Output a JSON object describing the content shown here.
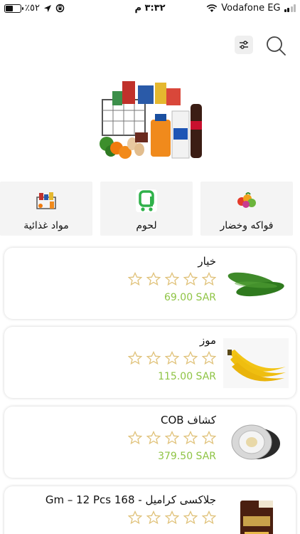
{
  "status_bar": {
    "battery_percent": "٪٥٢",
    "battery_level": 0.52,
    "time": "٣:٣٢ م",
    "carrier": "Vodafone EG"
  },
  "toolbar": {
    "filter_icon": "sliders-icon",
    "search_icon": "search-icon"
  },
  "hero": {
    "icon": "grocery-basket-illustration"
  },
  "categories": [
    {
      "label": "فواكه وخضار",
      "icon": "fruits-vegetables-icon"
    },
    {
      "label": "لحوم",
      "icon": "cart-logo-icon"
    },
    {
      "label": "مواد غذائية",
      "icon": "groceries-icon"
    }
  ],
  "products": [
    {
      "name": "خيار",
      "price": "69.00 SAR",
      "rating": 0,
      "image": "cucumber-image"
    },
    {
      "name": "موز",
      "price": "115.00 SAR",
      "rating": 0,
      "image": "banana-image"
    },
    {
      "name": "كشاف COB",
      "price": "379.50 SAR",
      "rating": 0,
      "image": "cob-spotlight-image"
    },
    {
      "name": "جلاكسى كراميل - 168 Gm – 12 Pcs",
      "price": "",
      "rating": 0,
      "image": "galaxy-chocolate-image"
    }
  ],
  "colors": {
    "price": "#8fc445",
    "star_outline": "#e0c27a",
    "category_bg": "#f4f4f4",
    "accent_green": "#2fb14a"
  }
}
